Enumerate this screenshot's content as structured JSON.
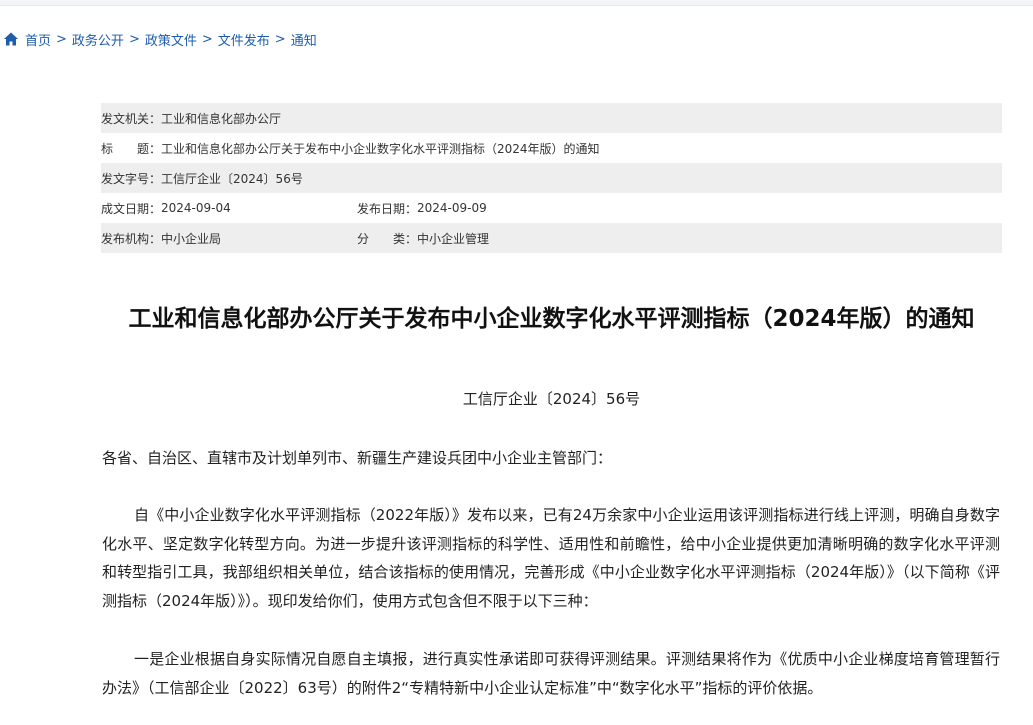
{
  "breadcrumb": {
    "home": "首页",
    "items": [
      "政务公开",
      "政策文件",
      "文件发布",
      "通知"
    ],
    "separator": ">"
  },
  "meta": {
    "issuer_label": "发文机关：",
    "issuer": "工业和信息化部办公厅",
    "title_label": "标　　题：",
    "title": "工业和信息化部办公厅关于发布中小企业数字化水平评测指标（2024年版）的通知",
    "doc_no_label": "发文字号：",
    "doc_no": "工信厅企业〔2024〕56号",
    "written_label": "成文日期：",
    "written_date": "2024-09-04",
    "published_label": "发布日期：",
    "published_date": "2024-09-09",
    "agency_label": "发布机构：",
    "agency": "中小企业局",
    "category_label": "分　　类：",
    "category": "中小企业管理"
  },
  "document": {
    "title": "工业和信息化部办公厅关于发布中小企业数字化水平评测指标（2024年版）的通知",
    "number": "工信厅企业〔2024〕56号",
    "recipients": "各省、自治区、直辖市及计划单列市、新疆生产建设兵团中小企业主管部门：",
    "paragraph_1": "自《中小企业数字化水平评测指标（2022年版）》发布以来，已有24万余家中小企业运用该评测指标进行线上评测，明确自身数字化水平、坚定数字化转型方向。为进一步提升该评测指标的科学性、适用性和前瞻性，给中小企业提供更加清晰明确的数字化水平评测和转型指引工具，我部组织相关单位，结合该指标的使用情况，完善形成《中小企业数字化水平评测指标（2024年版）》（以下简称《评测指标（2024年版）》）。现印发给你们，使用方式包含但不限于以下三种：",
    "paragraph_2": "一是企业根据自身实际情况自愿自主填报，进行真实性承诺即可获得评测结果。评测结果将作为《优质中小企业梯度培育管理暂行办法》（工信部企业〔2022〕63号）的附件2“专精特新中小企业认定标准”中“数字化水平”指标的评价依据。"
  },
  "colors": {
    "link": "#1d5dad",
    "meta_shade": "#eeeeee",
    "text": "#222222"
  }
}
